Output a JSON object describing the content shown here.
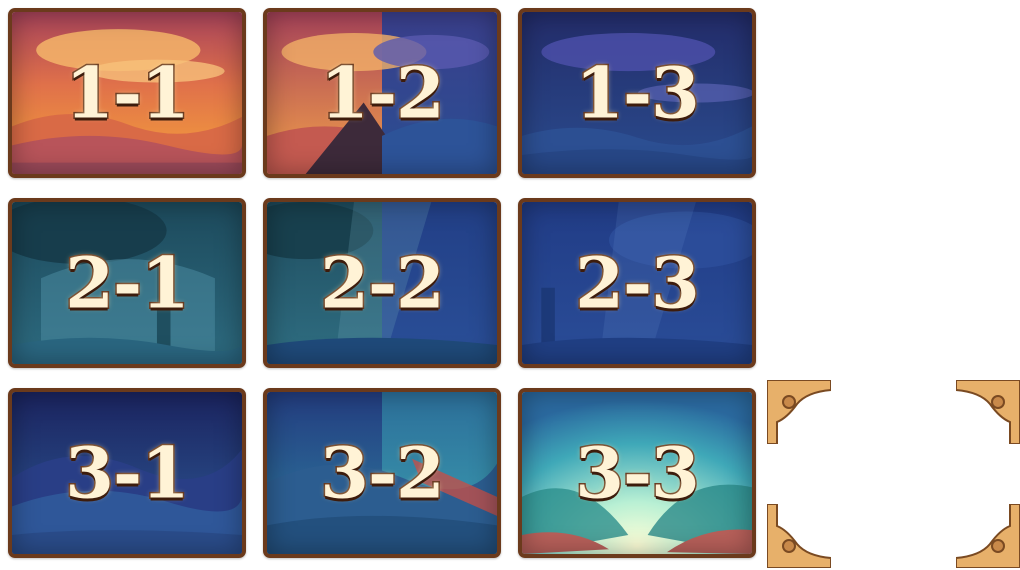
{
  "levels": [
    {
      "label": "1-1",
      "theme": "sunset"
    },
    {
      "label": "1-2",
      "theme": "sunset-to-night"
    },
    {
      "label": "1-3",
      "theme": "night"
    },
    {
      "label": "2-1",
      "theme": "forest-teal"
    },
    {
      "label": "2-2",
      "theme": "forest-mixed"
    },
    {
      "label": "2-3",
      "theme": "forest-blue"
    },
    {
      "label": "3-1",
      "theme": "mountain-night"
    },
    {
      "label": "3-2",
      "theme": "mountain-dawn"
    },
    {
      "label": "3-3",
      "theme": "sunrise"
    }
  ],
  "frame_corners": [
    "corner-ornament-icon",
    "corner-ornament-icon",
    "corner-ornament-icon",
    "corner-ornament-icon"
  ],
  "colors": {
    "tile_border": "#6b3a1c",
    "label_fill": "#fff3d6",
    "label_stroke": "#5a2a14",
    "corner_gold": "#e7b06a"
  }
}
